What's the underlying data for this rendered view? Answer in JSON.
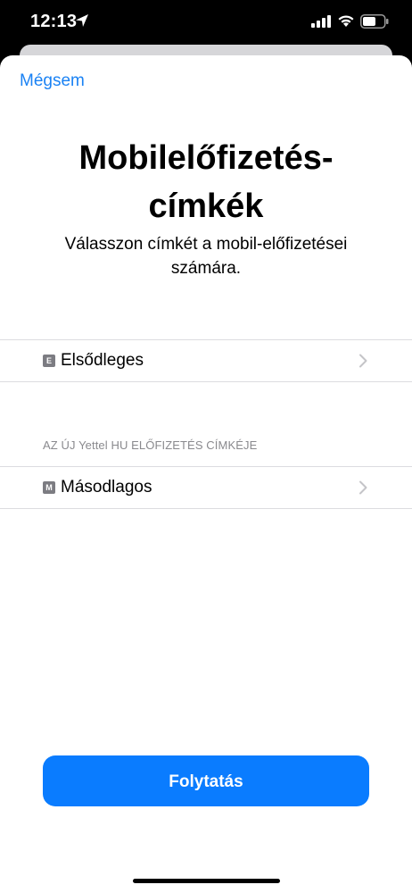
{
  "status_bar": {
    "time": "12:13",
    "icons": [
      "location-arrow-icon",
      "cellular-signal-icon",
      "wifi-icon",
      "battery-icon"
    ]
  },
  "sheet": {
    "cancel_label": "Mégsem",
    "title": "Mobilelőfizetés-\ncímkék",
    "subtitle": "Válasszon címkét a mobil-előfizetései számára.",
    "primary_row": {
      "badge": "E",
      "label": "Elsődleges"
    },
    "section_header": "AZ ÚJ Yettel HU ELŐFIZETÉS CÍMKÉJE",
    "secondary_row": {
      "badge": "M",
      "label": "Másodlagos"
    },
    "continue_label": "Folytatás"
  },
  "colors": {
    "accent": "#0a7cff",
    "link": "#1a82f4",
    "badge": "#7c7c82",
    "secondary_text": "#8a8a8e"
  }
}
